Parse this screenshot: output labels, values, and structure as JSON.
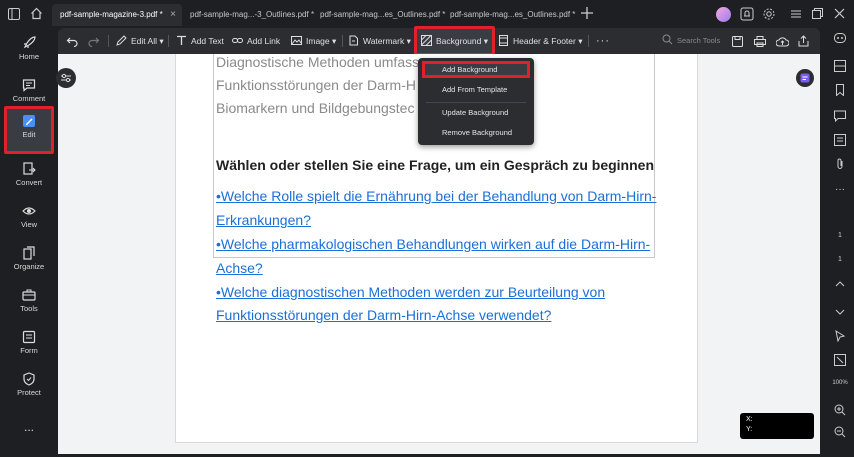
{
  "tabs": [
    {
      "label": "pdf-sample-magazine-3.pdf *",
      "active": true
    },
    {
      "label": "pdf-sample-mag...-3_Outlines.pdf *",
      "active": false
    },
    {
      "label": "pdf-sample-mag...es_Outlines.pdf *",
      "active": false
    },
    {
      "label": "pdf-sample-mag...es_Outlines.pdf *",
      "active": false
    }
  ],
  "sidebar": {
    "items": [
      {
        "label": "Home",
        "icon": "rocket-icon"
      },
      {
        "label": "Comment",
        "icon": "comment-icon"
      },
      {
        "label": "Edit",
        "icon": "edit-icon"
      },
      {
        "label": "Convert",
        "icon": "convert-icon"
      },
      {
        "label": "View",
        "icon": "eye-icon"
      },
      {
        "label": "Organize",
        "icon": "organize-icon"
      },
      {
        "label": "Tools",
        "icon": "toolbox-icon"
      },
      {
        "label": "Form",
        "icon": "form-icon"
      },
      {
        "label": "Protect",
        "icon": "shield-icon"
      }
    ],
    "more": "..."
  },
  "toolbar": {
    "edit_all": "Edit All",
    "add_text": "Add Text",
    "add_link": "Add Link",
    "image": "Image",
    "watermark": "Watermark",
    "background": "Background",
    "header_footer": "Header & Footer",
    "search_placeholder": "Search Tools"
  },
  "dropdown": {
    "items": [
      "Add Background",
      "Add From Template",
      "Update Background",
      "Remove Background"
    ]
  },
  "document": {
    "grey_lines": [
      "Diagnostische Methoden umfassen                       von",
      "Funktionsstörungen der Darm-H                         Rolle von",
      "Biomarkern und Bildgebungstec"
    ],
    "heading": "Wählen oder stellen Sie eine Frage, um ein Gespräch zu beginnen",
    "links": [
      "•Welche Rolle spielt die Ernährung bei der Behandlung von Darm-Hirn-",
      "Erkrankungen?",
      "•Welche pharmakologischen Behandlungen wirken auf die Darm-Hirn-",
      "Achse?",
      "•Welche diagnostischen Methoden werden zur Beurteilung von",
      "Funktionsstörungen der Darm-Hirn-Achse verwendet?"
    ]
  },
  "rightbar": {
    "page_current": "1",
    "page_total": "1",
    "zoom": "100%"
  },
  "coords": {
    "x_label": "X:",
    "y_label": "Y:"
  },
  "colors": {
    "accent_red": "#e0212c",
    "link_blue": "#1a6fd8",
    "dark_bg": "#1e1f22",
    "toolbar_bg": "#2b2d31"
  }
}
